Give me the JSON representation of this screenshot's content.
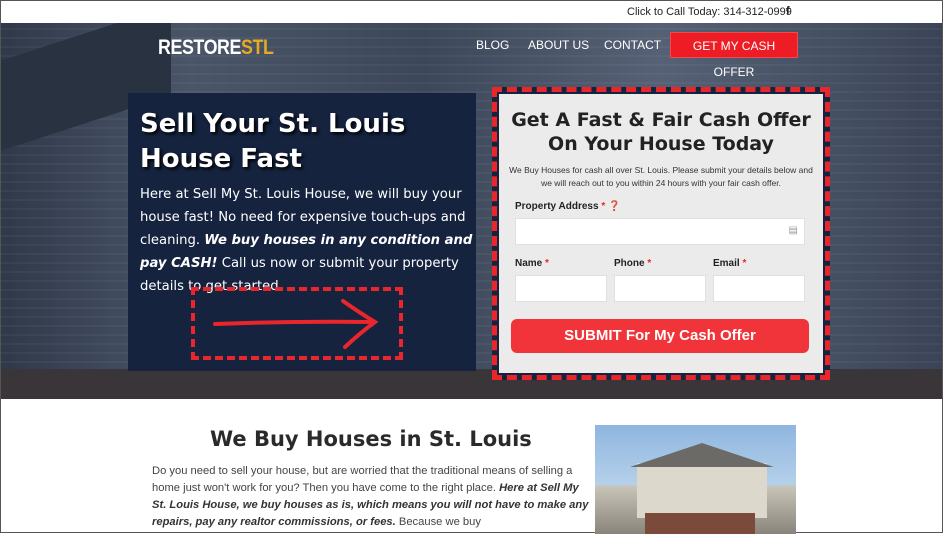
{
  "topbar": {
    "call": "Click to Call Today: 314-312-0999",
    "facebook_icon": "f"
  },
  "header": {
    "logo_main": "RESTORE",
    "logo_accent": "STL",
    "nav": [
      "BLOG",
      "ABOUT US",
      "CONTACT"
    ],
    "cta": "GET MY CASH OFFER"
  },
  "hero": {
    "title": "Sell Your St. Louis House Fast",
    "text_1": "Here at Sell My St. Louis House, we will buy your house fast! No need for expensive touch-ups and cleaning. ",
    "text_bold": "We buy houses in any condition and pay CASH!",
    "text_2": " Call us now or submit your property details to get started."
  },
  "form": {
    "title": "Get A Fast & Fair Cash Offer On Your House Today",
    "desc": "We Buy Houses for cash all over St. Louis. Please submit your details below and we will reach out to you within 24 hours with your fair cash offer.",
    "address_label": "Property Address",
    "name_label": "Name",
    "phone_label": "Phone",
    "email_label": "Email",
    "required": "*",
    "submit": "SUBMIT For My Cash Offer"
  },
  "section": {
    "title": "We Buy Houses in St. Louis",
    "text_1": "Do you need to sell your house, but are worried that the traditional means of selling a home just won't work for you? Then you have come to the right place. ",
    "text_bold": "Here at Sell My St. Louis House, we buy houses as is, which means you will not have to make any repairs, pay any realtor commissions, or fees.",
    "text_2": " Because we buy"
  },
  "colors": {
    "accent": "#ee1c25",
    "panel": "#15233f",
    "logo_accent": "#e6a925"
  }
}
